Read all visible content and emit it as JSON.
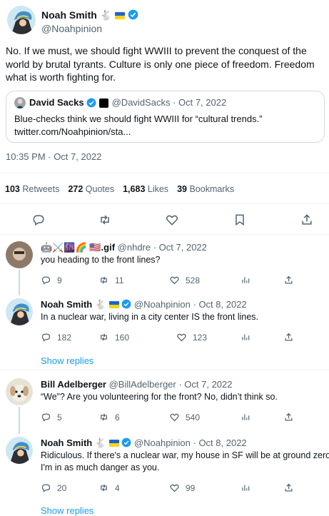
{
  "main": {
    "author_name": "Noah Smith",
    "handle": "@Noahpinion",
    "text": "No. If we must, we should fight WWIII to prevent the conquest of the world by brutal tyrants. Culture is only one piece of freedom. Freedom what is worth fighting for.",
    "timestamp": "10:35 PM · Oct 7, 2022",
    "quote": {
      "author_name": "David Sacks",
      "handle_date": "@DavidSacks · Oct 7, 2022",
      "text": "Blue-checks think we should fight WWIII for “cultural trends.”",
      "link": "twitter.com/Noahpinion/sta..."
    },
    "stats": [
      {
        "num": "103",
        "label": "Retweets"
      },
      {
        "num": "272",
        "label": "Quotes"
      },
      {
        "num": "1,683",
        "label": "Likes"
      },
      {
        "num": "39",
        "label": "Bookmarks"
      }
    ]
  },
  "replies": [
    {
      "name": "🤖⚔️🌆🌈 🇺🇸.gif",
      "handle_date": "@nhdre · Oct 7, 2022",
      "text": "you heading to the front lines?",
      "replies": "9",
      "retweets": "11",
      "likes": "528"
    },
    {
      "name": "Noah Smith",
      "handle_date": "@Noahpinion · Oct 8, 2022",
      "text": "In a nuclear war, living in a city center IS the front lines.",
      "replies": "182",
      "retweets": "160",
      "likes": "123",
      "show_replies": "Show replies"
    },
    {
      "name": "Bill Adelberger",
      "handle_date": "@BillAdelberger · Oct 7, 2022",
      "text": "“We”?  Are you volunteering for the front?  No, didn’t think so.",
      "replies": "5",
      "retweets": "6",
      "likes": "540"
    },
    {
      "name": "Noah Smith",
      "handle_date": "@Noahpinion · Oct 8, 2022",
      "text": "Ridiculous. If there's a nuclear war, my house in SF will be at ground zero.",
      "text2": "I'm in as much danger as you.",
      "replies": "20",
      "retweets": "4",
      "likes": "99",
      "show_replies": "Show replies"
    }
  ],
  "colors": {
    "accent": "#1d9bf0",
    "text": "#0f1419",
    "muted": "#536471",
    "border": "#cfd9de"
  }
}
